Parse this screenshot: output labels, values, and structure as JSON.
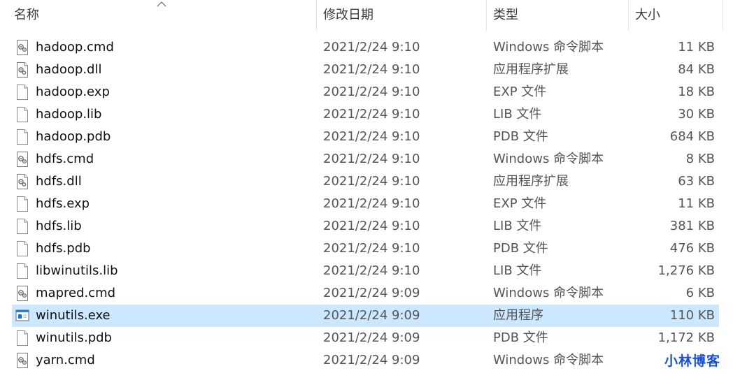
{
  "header": {
    "name_label": "名称",
    "date_label": "修改日期",
    "type_label": "类型",
    "size_label": "大小"
  },
  "files": [
    {
      "name": "hadoop.cmd",
      "date": "2021/2/24 9:10",
      "type": "Windows 命令脚本",
      "size": "11 KB",
      "icon": "script-file-icon"
    },
    {
      "name": "hadoop.dll",
      "date": "2021/2/24 9:10",
      "type": "应用程序扩展",
      "size": "84 KB",
      "icon": "dll-file-icon"
    },
    {
      "name": "hadoop.exp",
      "date": "2021/2/24 9:10",
      "type": "EXP 文件",
      "size": "18 KB",
      "icon": "blank-file-icon"
    },
    {
      "name": "hadoop.lib",
      "date": "2021/2/24 9:10",
      "type": "LIB 文件",
      "size": "30 KB",
      "icon": "blank-file-icon"
    },
    {
      "name": "hadoop.pdb",
      "date": "2021/2/24 9:10",
      "type": "PDB 文件",
      "size": "684 KB",
      "icon": "blank-file-icon"
    },
    {
      "name": "hdfs.cmd",
      "date": "2021/2/24 9:10",
      "type": "Windows 命令脚本",
      "size": "8 KB",
      "icon": "script-file-icon"
    },
    {
      "name": "hdfs.dll",
      "date": "2021/2/24 9:10",
      "type": "应用程序扩展",
      "size": "63 KB",
      "icon": "dll-file-icon"
    },
    {
      "name": "hdfs.exp",
      "date": "2021/2/24 9:10",
      "type": "EXP 文件",
      "size": "11 KB",
      "icon": "blank-file-icon"
    },
    {
      "name": "hdfs.lib",
      "date": "2021/2/24 9:10",
      "type": "LIB 文件",
      "size": "381 KB",
      "icon": "blank-file-icon"
    },
    {
      "name": "hdfs.pdb",
      "date": "2021/2/24 9:10",
      "type": "PDB 文件",
      "size": "476 KB",
      "icon": "blank-file-icon"
    },
    {
      "name": "libwinutils.lib",
      "date": "2021/2/24 9:10",
      "type": "LIB 文件",
      "size": "1,276 KB",
      "icon": "blank-file-icon"
    },
    {
      "name": "mapred.cmd",
      "date": "2021/2/24 9:09",
      "type": "Windows 命令脚本",
      "size": "6 KB",
      "icon": "script-file-icon"
    },
    {
      "name": "winutils.exe",
      "date": "2021/2/24 9:09",
      "type": "应用程序",
      "size": "110 KB",
      "icon": "exe-file-icon",
      "selected": true
    },
    {
      "name": "winutils.pdb",
      "date": "2021/2/24 9:09",
      "type": "PDB 文件",
      "size": "1,172 KB",
      "icon": "blank-file-icon"
    },
    {
      "name": "yarn.cmd",
      "date": "2021/2/24 9:09",
      "type": "Windows 命令脚本",
      "size": "",
      "icon": "script-file-icon"
    }
  ],
  "watermark": "小林博客",
  "colors": {
    "selection": "#cce8ff",
    "watermark": "#1a4fd8"
  }
}
